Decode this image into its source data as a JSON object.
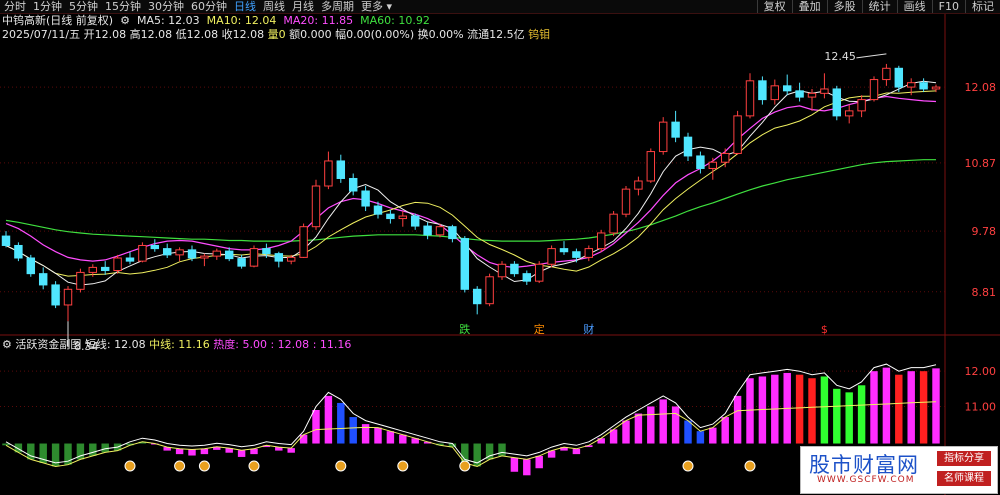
{
  "toolbar": {
    "tabs": [
      "分时",
      "1分钟",
      "5分钟",
      "15分钟",
      "30分钟",
      "60分钟",
      "日线",
      "周线",
      "月线",
      "多周期",
      "更多"
    ],
    "active_tab": "日线",
    "right_tools": [
      "复权",
      "叠加",
      "多股",
      "统计",
      "画线",
      "F10",
      "标记"
    ]
  },
  "header": {
    "stock": "中钨高新(日线 前复权)",
    "ma5": "MA5: 12.03",
    "ma10": "MA10: 12.04",
    "ma20": "MA20: 11.85",
    "ma60": "MA60: 10.92",
    "date": "2025/07/11/五",
    "open": "开12.08",
    "high": "高12.08",
    "low": "低12.08",
    "close": "收12.08",
    "volume": "量0",
    "amount": "额0.000",
    "range": "幅0.00(0.00%)",
    "turnover": "换0.00%",
    "float": "流通12.5亿",
    "concept": "钨钼"
  },
  "lower_header": {
    "name": "活跃资金副图",
    "short": "短线: 12.08",
    "mid": "中线: 11.16",
    "heat": "热度: 5.00",
    "v1": ": 12.08",
    "v2": ": 11.16"
  },
  "annotations": {
    "high_label": "12.45",
    "low_label": "8.34",
    "tags": [
      "跌",
      "定",
      "财",
      "$"
    ]
  },
  "watermark": {
    "logo": "股市财富网",
    "url": "WWW.GSCFW.COM",
    "tag1": "指标分享",
    "tag2": "名师课程"
  },
  "colors": {
    "up": "#ff4040",
    "down": "#50e6ff",
    "ma5": "#f0f0f0",
    "ma10": "#f0f060",
    "ma20": "#ff4dff",
    "ma60": "#3fe03f",
    "lower_pink": "#ff2dff",
    "lower_green": "#2e8b2e",
    "lower_blue": "#2050ff",
    "lower_red": "#ff2020",
    "lower_lime": "#30ff30"
  },
  "chart_data": [
    {
      "type": "candlestick",
      "title": "中钨高新(日线 前复权)",
      "y_ticks": [
        8.81,
        9.78,
        10.87,
        12.08
      ],
      "ylim": [
        8.2,
        12.8
      ],
      "annotations": [
        {
          "label": "12.45",
          "kind": "high"
        },
        {
          "label": "8.34",
          "kind": "low"
        }
      ],
      "ohlc": [
        [
          9.7,
          9.78,
          9.52,
          9.55
        ],
        [
          9.55,
          9.6,
          9.3,
          9.35
        ],
        [
          9.35,
          9.4,
          9.05,
          9.1
        ],
        [
          9.1,
          9.2,
          8.85,
          8.92
        ],
        [
          8.92,
          8.98,
          8.55,
          8.6
        ],
        [
          8.6,
          8.9,
          8.34,
          8.85
        ],
        [
          8.85,
          9.18,
          8.8,
          9.12
        ],
        [
          9.12,
          9.25,
          9.05,
          9.2
        ],
        [
          9.2,
          9.3,
          9.08,
          9.15
        ],
        [
          9.15,
          9.4,
          9.1,
          9.35
        ],
        [
          9.35,
          9.45,
          9.25,
          9.3
        ],
        [
          9.3,
          9.6,
          9.28,
          9.55
        ],
        [
          9.55,
          9.65,
          9.45,
          9.5
        ],
        [
          9.5,
          9.58,
          9.35,
          9.4
        ],
        [
          9.4,
          9.52,
          9.3,
          9.48
        ],
        [
          9.48,
          9.55,
          9.3,
          9.35
        ],
        [
          9.35,
          9.42,
          9.22,
          9.38
        ],
        [
          9.38,
          9.5,
          9.32,
          9.46
        ],
        [
          9.46,
          9.52,
          9.3,
          9.34
        ],
        [
          9.34,
          9.4,
          9.18,
          9.22
        ],
        [
          9.22,
          9.55,
          9.2,
          9.5
        ],
        [
          9.5,
          9.58,
          9.35,
          9.42
        ],
        [
          9.42,
          9.45,
          9.2,
          9.3
        ],
        [
          9.3,
          9.4,
          9.25,
          9.36
        ],
        [
          9.36,
          9.9,
          9.35,
          9.85
        ],
        [
          9.85,
          10.6,
          9.8,
          10.5
        ],
        [
          10.5,
          11.05,
          10.45,
          10.9
        ],
        [
          10.9,
          11.0,
          10.55,
          10.62
        ],
        [
          10.62,
          10.7,
          10.35,
          10.42
        ],
        [
          10.42,
          10.5,
          10.1,
          10.18
        ],
        [
          10.18,
          10.25,
          9.98,
          10.05
        ],
        [
          10.05,
          10.12,
          9.9,
          9.98
        ],
        [
          9.98,
          10.1,
          9.85,
          10.02
        ],
        [
          10.02,
          10.06,
          9.8,
          9.86
        ],
        [
          9.86,
          9.92,
          9.65,
          9.72
        ],
        [
          9.72,
          9.9,
          9.68,
          9.85
        ],
        [
          9.85,
          9.88,
          9.6,
          9.66
        ],
        [
          9.66,
          9.7,
          8.8,
          8.85
        ],
        [
          8.85,
          8.9,
          8.45,
          8.62
        ],
        [
          8.62,
          9.1,
          8.58,
          9.05
        ],
        [
          9.05,
          9.3,
          9.0,
          9.25
        ],
        [
          9.25,
          9.3,
          9.05,
          9.1
        ],
        [
          9.1,
          9.15,
          8.92,
          8.98
        ],
        [
          8.98,
          9.3,
          8.95,
          9.25
        ],
        [
          9.25,
          9.55,
          9.2,
          9.5
        ],
        [
          9.5,
          9.62,
          9.4,
          9.45
        ],
        [
          9.45,
          9.5,
          9.28,
          9.36
        ],
        [
          9.36,
          9.55,
          9.3,
          9.5
        ],
        [
          9.5,
          9.8,
          9.45,
          9.75
        ],
        [
          9.75,
          10.1,
          9.7,
          10.05
        ],
        [
          10.05,
          10.5,
          10.0,
          10.45
        ],
        [
          10.45,
          10.65,
          10.35,
          10.58
        ],
        [
          10.58,
          11.1,
          10.55,
          11.05
        ],
        [
          11.05,
          11.6,
          11.0,
          11.52
        ],
        [
          11.52,
          11.7,
          11.2,
          11.28
        ],
        [
          11.28,
          11.35,
          10.9,
          10.98
        ],
        [
          10.98,
          11.05,
          10.7,
          10.78
        ],
        [
          10.78,
          10.95,
          10.6,
          10.88
        ],
        [
          10.88,
          11.1,
          10.8,
          11.02
        ],
        [
          11.02,
          11.7,
          11.0,
          11.62
        ],
        [
          11.62,
          12.3,
          11.58,
          12.18
        ],
        [
          12.18,
          12.25,
          11.8,
          11.88
        ],
        [
          11.88,
          12.2,
          11.8,
          12.1
        ],
        [
          12.1,
          12.28,
          11.95,
          12.02
        ],
        [
          12.02,
          12.15,
          11.85,
          11.92
        ],
        [
          11.92,
          12.05,
          11.7,
          11.98
        ],
        [
          11.98,
          12.3,
          11.9,
          12.05
        ],
        [
          12.05,
          12.1,
          11.55,
          11.62
        ],
        [
          11.62,
          11.8,
          11.5,
          11.7
        ],
        [
          11.7,
          11.95,
          11.6,
          11.88
        ],
        [
          11.88,
          12.25,
          11.85,
          12.2
        ],
        [
          12.2,
          12.45,
          12.1,
          12.38
        ],
        [
          12.38,
          12.42,
          12.0,
          12.08
        ],
        [
          12.08,
          12.22,
          11.95,
          12.15
        ],
        [
          12.15,
          12.22,
          12.0,
          12.05
        ],
        [
          12.05,
          12.12,
          12.0,
          12.08
        ]
      ],
      "ma20_points": [
        9.9,
        9.82,
        9.7,
        9.56,
        9.45,
        9.36,
        9.32,
        9.3,
        9.32,
        9.38,
        9.45,
        9.52,
        9.58,
        9.62,
        9.63,
        9.62,
        9.58,
        9.54,
        9.5,
        9.48,
        9.48,
        9.5,
        9.55,
        9.62,
        9.78,
        9.98,
        10.15,
        10.25,
        10.3,
        10.28,
        10.22,
        10.15,
        10.1,
        10.05,
        9.98,
        9.88,
        9.72,
        9.55,
        9.4,
        9.28,
        9.22,
        9.2,
        9.22,
        9.25,
        9.28,
        9.3,
        9.32,
        9.36,
        9.45,
        9.58,
        9.75,
        9.92,
        10.12,
        10.35,
        10.55,
        10.68,
        10.78,
        10.9,
        11.05,
        11.25,
        11.42,
        11.58,
        11.68,
        11.75,
        11.78,
        11.72,
        11.7,
        11.74,
        11.8,
        11.85,
        11.9,
        11.93,
        11.9,
        11.88,
        11.86,
        11.85
      ],
      "ma60_points": [
        9.95,
        9.92,
        9.88,
        9.84,
        9.8,
        9.77,
        9.75,
        9.73,
        9.72,
        9.71,
        9.7,
        9.69,
        9.68,
        9.67,
        9.66,
        9.65,
        9.65,
        9.64,
        9.63,
        9.63,
        9.62,
        9.62,
        9.62,
        9.62,
        9.63,
        9.64,
        9.66,
        9.68,
        9.7,
        9.71,
        9.72,
        9.72,
        9.72,
        9.72,
        9.71,
        9.7,
        9.68,
        9.66,
        9.64,
        9.63,
        9.62,
        9.62,
        9.62,
        9.62,
        9.63,
        9.64,
        9.65,
        9.67,
        9.7,
        9.73,
        9.77,
        9.82,
        9.88,
        9.95,
        10.02,
        10.1,
        10.17,
        10.23,
        10.3,
        10.37,
        10.44,
        10.5,
        10.55,
        10.6,
        10.64,
        10.68,
        10.72,
        10.76,
        10.8,
        10.84,
        10.87,
        10.89,
        10.9,
        10.91,
        10.92,
        10.92
      ]
    },
    {
      "type": "bar",
      "title": "活跃资金副图",
      "y_ticks": [
        11.0,
        12.0
      ],
      "ylim": [
        9.2,
        12.6
      ],
      "values": [
        9.9,
        9.7,
        9.5,
        9.4,
        9.3,
        9.35,
        9.5,
        9.6,
        9.7,
        9.75,
        9.9,
        10.0,
        9.95,
        9.85,
        9.8,
        9.78,
        9.8,
        9.86,
        9.82,
        9.76,
        9.8,
        9.9,
        9.85,
        9.82,
        10.2,
        10.9,
        11.3,
        11.1,
        10.7,
        10.5,
        10.4,
        10.3,
        10.2,
        10.1,
        10.0,
        9.9,
        9.85,
        9.4,
        9.3,
        9.5,
        9.6,
        9.55,
        9.5,
        9.6,
        9.75,
        9.85,
        9.8,
        9.9,
        10.1,
        10.35,
        10.6,
        10.8,
        11.0,
        11.2,
        11.0,
        10.6,
        10.3,
        10.4,
        10.7,
        11.3,
        11.8,
        11.85,
        11.9,
        11.95,
        11.9,
        11.8,
        11.85,
        11.5,
        11.4,
        11.6,
        12.0,
        12.1,
        11.9,
        12.0,
        12.0,
        12.08
      ],
      "color_class": [
        1,
        1,
        1,
        1,
        1,
        1,
        1,
        1,
        1,
        1,
        1,
        1,
        0,
        0,
        0,
        0,
        0,
        0,
        0,
        0,
        0,
        0,
        0,
        0,
        0,
        0,
        0,
        2,
        2,
        0,
        0,
        0,
        0,
        0,
        0,
        1,
        1,
        1,
        1,
        1,
        1,
        0,
        0,
        0,
        0,
        0,
        0,
        0,
        0,
        0,
        0,
        0,
        0,
        0,
        0,
        2,
        2,
        0,
        0,
        0,
        0,
        0,
        0,
        0,
        3,
        3,
        4,
        4,
        4,
        4,
        0,
        0,
        3,
        0,
        3,
        0
      ],
      "short_line": 12.08,
      "mid_line": 11.16
    }
  ]
}
